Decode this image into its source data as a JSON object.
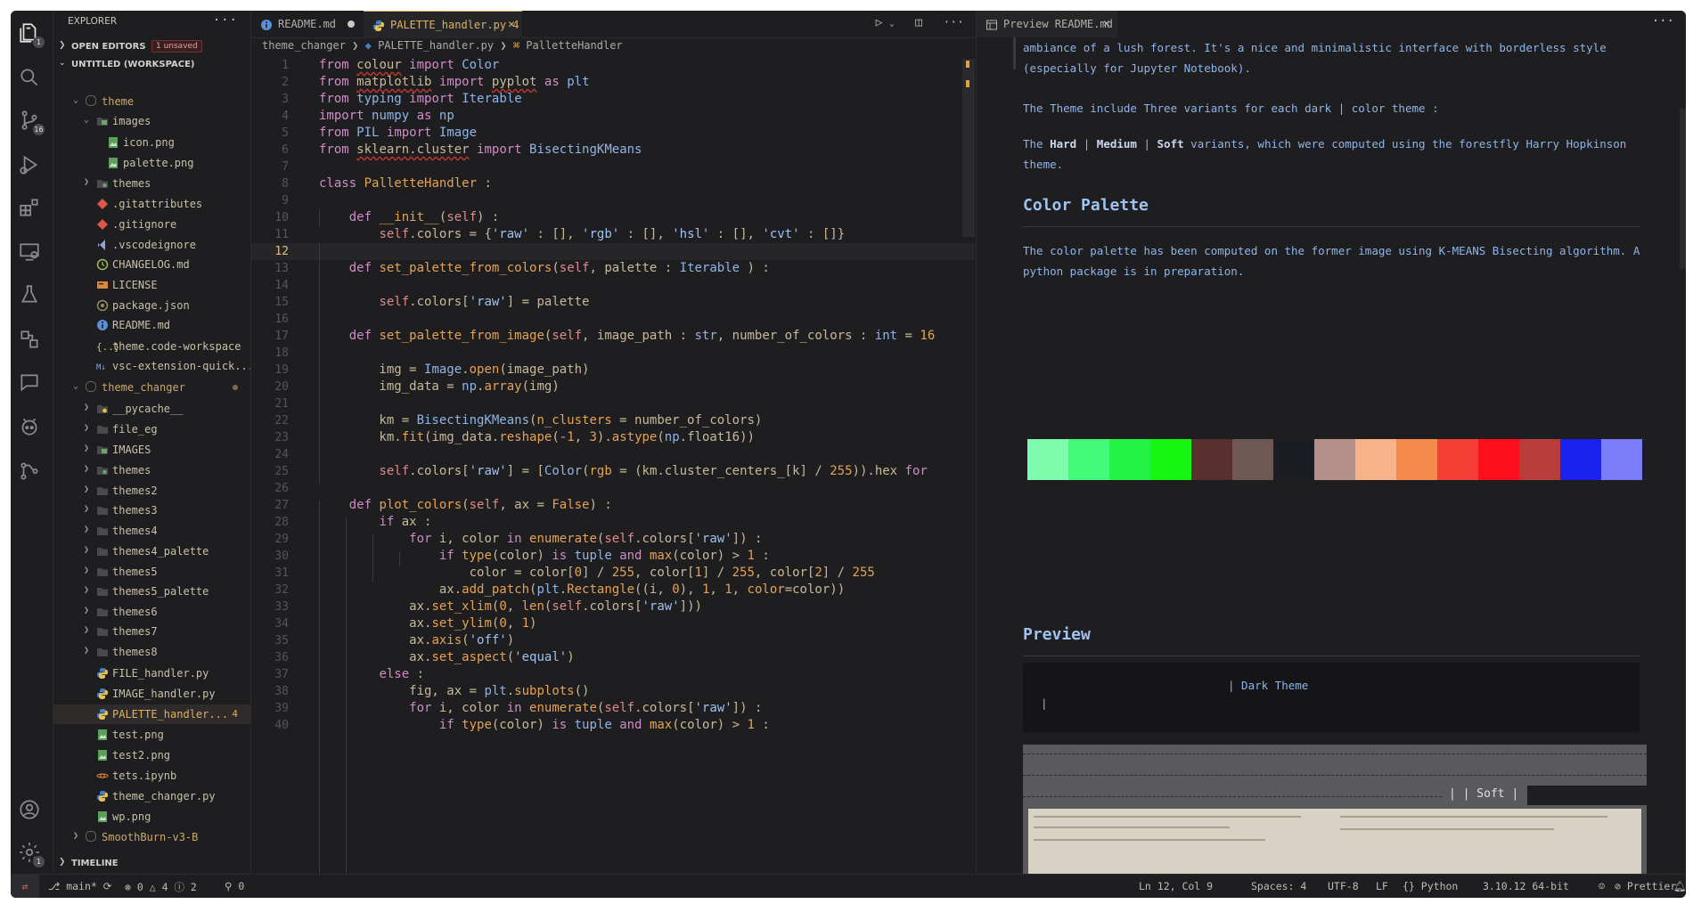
{
  "sidebar": {
    "title": "EXPLORER",
    "open_editors": "OPEN EDITORS",
    "unsaved": "1 unsaved",
    "workspace": "UNTITLED (WORKSPACE)",
    "timeline": "TIMELINE",
    "items": [
      {
        "label": "theme",
        "depth": 0,
        "type": "root",
        "open": true
      },
      {
        "label": "images",
        "depth": 1,
        "type": "folder-img",
        "open": true
      },
      {
        "label": "icon.png",
        "depth": 2,
        "type": "image"
      },
      {
        "label": "palette.png",
        "depth": 2,
        "type": "image"
      },
      {
        "label": "themes",
        "depth": 1,
        "type": "folder-special",
        "open": false
      },
      {
        "label": ".gitattributes",
        "depth": 1,
        "type": "git"
      },
      {
        "label": ".gitignore",
        "depth": 1,
        "type": "git"
      },
      {
        "label": ".vscodeignore",
        "depth": 1,
        "type": "vscode"
      },
      {
        "label": "CHANGELOG.md",
        "depth": 1,
        "type": "changelog"
      },
      {
        "label": "LICENSE",
        "depth": 1,
        "type": "license"
      },
      {
        "label": "package.json",
        "depth": 1,
        "type": "npm"
      },
      {
        "label": "README.md",
        "depth": 1,
        "type": "info"
      },
      {
        "label": "theme.code-workspace",
        "depth": 1,
        "type": "json"
      },
      {
        "label": "vsc-extension-quick...",
        "depth": 1,
        "type": "md"
      },
      {
        "label": "theme_changer",
        "depth": 0,
        "type": "root",
        "open": true,
        "modified": true
      },
      {
        "label": "__pycache__",
        "depth": 1,
        "type": "folder-py",
        "open": false
      },
      {
        "label": "file_eg",
        "depth": 1,
        "type": "folder",
        "open": false
      },
      {
        "label": "IMAGES",
        "depth": 1,
        "type": "folder-img",
        "open": false
      },
      {
        "label": "themes",
        "depth": 1,
        "type": "folder-special",
        "open": false
      },
      {
        "label": "themes2",
        "depth": 1,
        "type": "folder",
        "open": false
      },
      {
        "label": "themes3",
        "depth": 1,
        "type": "folder",
        "open": false
      },
      {
        "label": "themes4",
        "depth": 1,
        "type": "folder",
        "open": false
      },
      {
        "label": "themes4_palette",
        "depth": 1,
        "type": "folder",
        "open": false
      },
      {
        "label": "themes5",
        "depth": 1,
        "type": "folder",
        "open": false
      },
      {
        "label": "themes5_palette",
        "depth": 1,
        "type": "folder",
        "open": false
      },
      {
        "label": "themes6",
        "depth": 1,
        "type": "folder",
        "open": false
      },
      {
        "label": "themes7",
        "depth": 1,
        "type": "folder",
        "open": false
      },
      {
        "label": "themes8",
        "depth": 1,
        "type": "folder",
        "open": false
      },
      {
        "label": "FILE_handler.py",
        "depth": 1,
        "type": "python"
      },
      {
        "label": "IMAGE_handler.py",
        "depth": 1,
        "type": "python"
      },
      {
        "label": "PALETTE_handler...",
        "depth": 1,
        "type": "python",
        "active": true,
        "badge": "4"
      },
      {
        "label": "test.png",
        "depth": 1,
        "type": "image"
      },
      {
        "label": "test2.png",
        "depth": 1,
        "type": "image"
      },
      {
        "label": "tets.ipynb",
        "depth": 1,
        "type": "notebook"
      },
      {
        "label": "theme_changer.py",
        "depth": 1,
        "type": "python"
      },
      {
        "label": "wp.png",
        "depth": 1,
        "type": "image"
      },
      {
        "label": "SmoothBurn-v3-B",
        "depth": 0,
        "type": "root",
        "open": false
      }
    ]
  },
  "tabs": [
    {
      "label": "README.md",
      "icon": "info-icon",
      "modified": true
    },
    {
      "label": "PALETTE_handler.py",
      "icon": "python-icon",
      "badge": "4",
      "active": true
    }
  ],
  "breadcrumb": {
    "a": "theme_changer",
    "b": "PALETTE_handler.py",
    "c": "PalletteHandler"
  },
  "preview_tab": {
    "label": "Preview README.md"
  },
  "code_lines": [
    "1",
    "2",
    "3",
    "4",
    "5",
    "6",
    "7",
    "8",
    "9",
    "10",
    "11",
    "12",
    "13",
    "14",
    "15",
    "16",
    "17",
    "18",
    "19",
    "20",
    "21",
    "22",
    "23",
    "24",
    "25",
    "26",
    "27",
    "28",
    "29",
    "30",
    "31",
    "32",
    "33",
    "34",
    "35",
    "36",
    "37",
    "38",
    "39",
    "40"
  ],
  "preview": {
    "p1": "ambiance of a lush forest. It's a nice and minimalistic interface with borderless style (especially for Jupyter Notebook).",
    "p2": "The Theme include Three variants for each dark | color theme :",
    "p3a": "The ",
    "p3b": "Hard",
    "p3c": " | ",
    "p3d": "Medium",
    "p3e": " | ",
    "p3f": "Soft",
    "p3g": " variants, which were computed using the forestfly Harry Hopkinson theme.",
    "h_palette": "Color Palette",
    "p4": "The color palette has been computed on the former image using K-MEANS Bisecting algorithm. A python package is in preparation.",
    "h_preview": "Preview",
    "dark_theme": "| Dark Theme",
    "pipe": "|",
    "soft": "| | Soft |",
    "swatches": [
      "#7dfcae",
      "#42f97a",
      "#24f445",
      "#17f612",
      "#5a2f2f",
      "#6e5855",
      "#1b1d24",
      "#b39088",
      "#f7b289",
      "#f58a4d",
      "#f53e36",
      "#ff0f1d",
      "#b83d3b",
      "#1c22ee",
      "#7a7df7"
    ]
  },
  "status": {
    "branch": "main*",
    "errors": "0",
    "warnings": "4",
    "info": "2",
    "ports": "0",
    "position": "Ln 12, Col 9",
    "spaces": "Spaces: 4",
    "encoding": "UTF-8",
    "eol": "LF",
    "language": "Python",
    "interpreter": "3.10.12 64-bit",
    "prettier": "Prettier"
  },
  "badges": {
    "account": "1",
    "scm": "16",
    "settings": "1"
  }
}
